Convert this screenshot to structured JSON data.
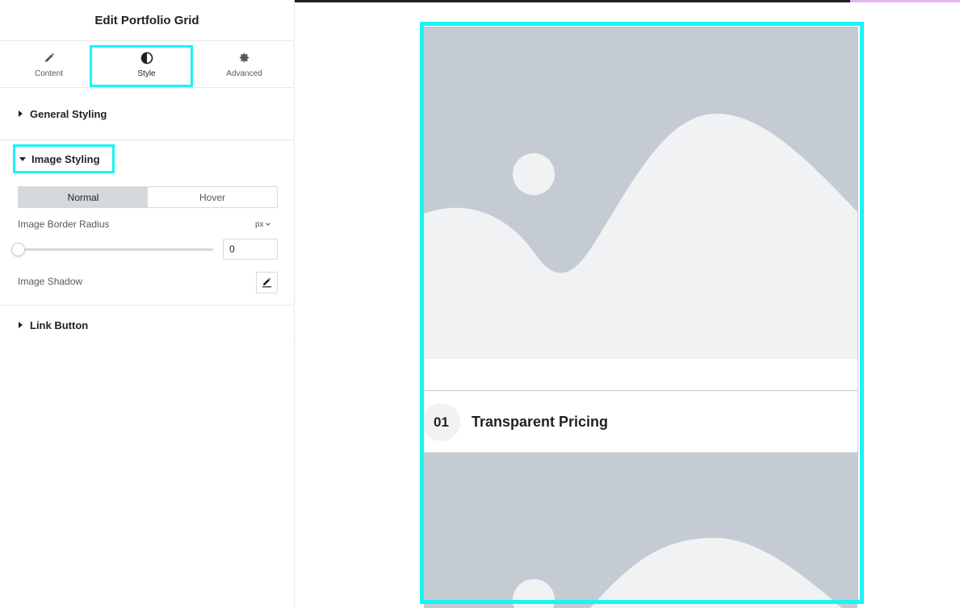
{
  "panel": {
    "title": "Edit Portfolio Grid",
    "tabs": [
      {
        "label": "Content",
        "icon": "pencil-icon"
      },
      {
        "label": "Style",
        "icon": "half-circle-icon",
        "active": true
      },
      {
        "label": "Advanced",
        "icon": "gear-icon"
      }
    ],
    "sections": {
      "general_styling": "General Styling",
      "image_styling": "Image Styling",
      "link_button": "Link Button"
    },
    "image_styling": {
      "toggle_normal": "Normal",
      "toggle_hover": "Hover",
      "border_radius_label": "Image Border Radius",
      "unit": "px",
      "border_radius_value": "0",
      "shadow_label": "Image Shadow"
    }
  },
  "preview": {
    "item_number": "01",
    "item_title": "Transparent Pricing"
  },
  "colors": {
    "highlight": "#19f4f4",
    "placeholder_bg": "#c4cbd3",
    "placeholder_fg": "#f0f2f4"
  }
}
